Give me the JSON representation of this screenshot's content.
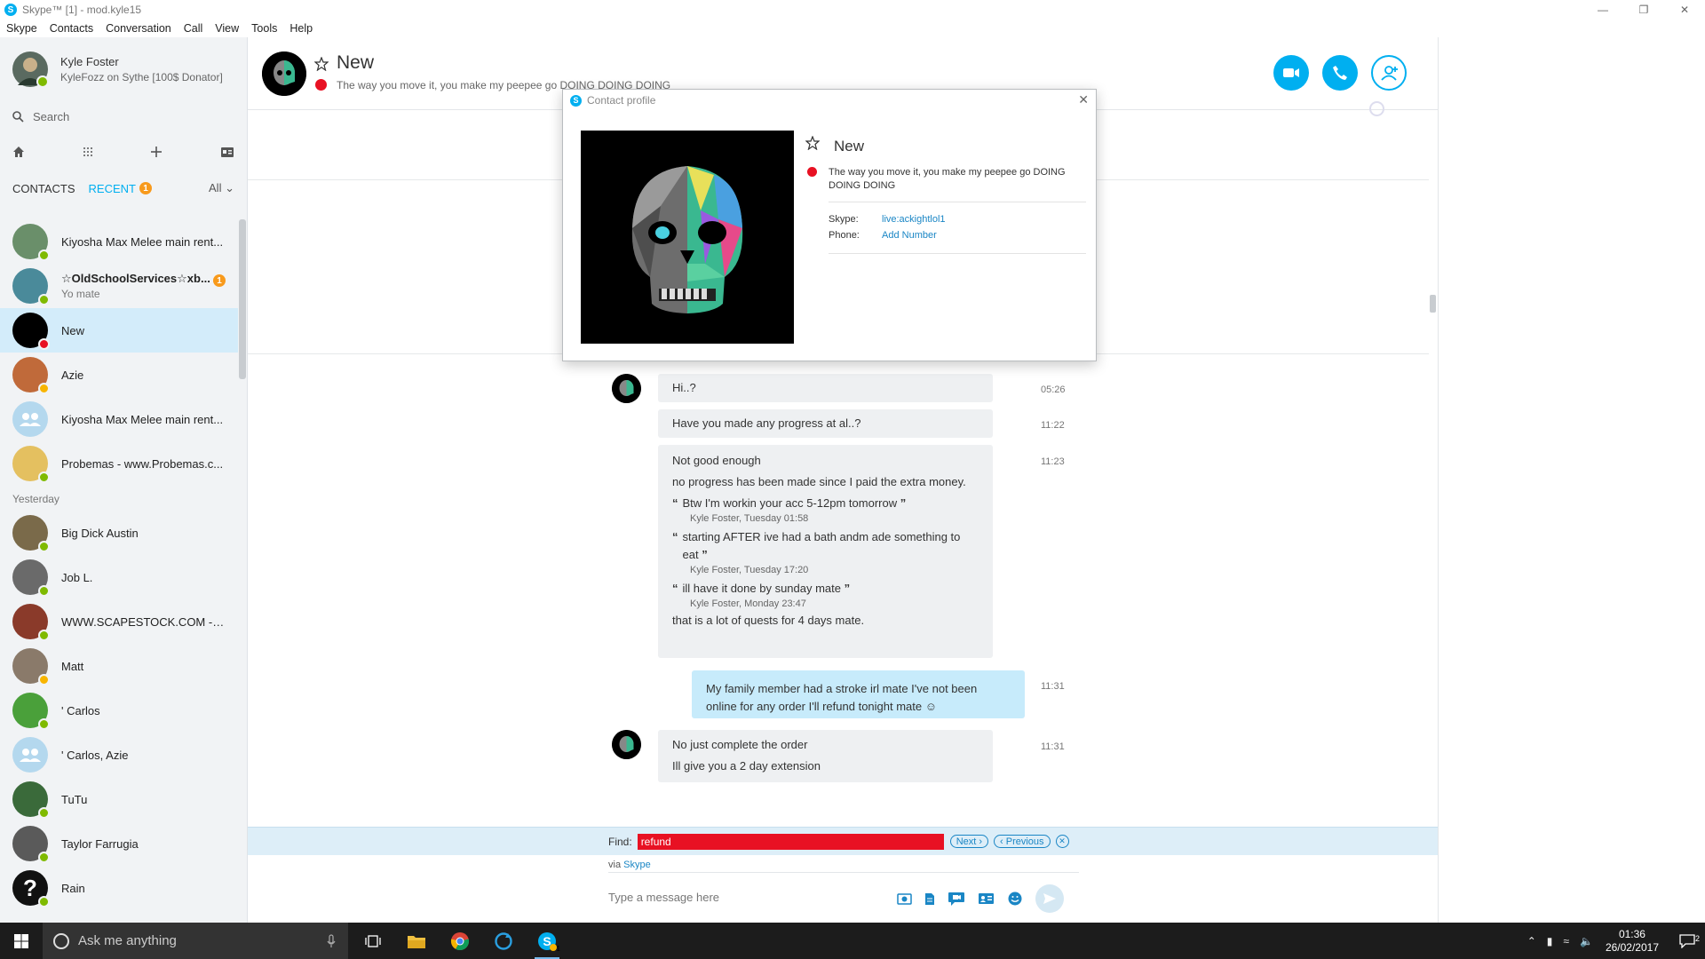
{
  "window": {
    "title": "Skype™ [1] - mod.kyle15"
  },
  "menu": [
    "Skype",
    "Contacts",
    "Conversation",
    "Call",
    "View",
    "Tools",
    "Help"
  ],
  "me": {
    "name": "Kyle Foster",
    "mood": "KyleFozz on Sythe [100$ Donator]"
  },
  "search": {
    "placeholder": "Search"
  },
  "tabs": {
    "contacts": "CONTACTS",
    "recent": "RECENT",
    "recent_badge": "1",
    "filter": "All"
  },
  "recent": [
    {
      "name": "Kiyosha Max Melee main rent...",
      "sub": "",
      "status": "on",
      "color": "#6a8f6a"
    },
    {
      "name": "☆OldSchoolServices☆xb...",
      "sub": "Yo mate",
      "status": "on",
      "color": "#4a8a9a",
      "bold": true,
      "badge": "1"
    },
    {
      "name": "New",
      "sub": "",
      "status": "dnd",
      "color": "#000000",
      "selected": true
    },
    {
      "name": "Azie",
      "sub": "",
      "status": "away",
      "color": "#c06a3a"
    },
    {
      "name": "Kiyosha Max Melee main rent...",
      "sub": "",
      "status": "",
      "color": "#b4d8ee",
      "group": true
    },
    {
      "name": "Probemas - www.Probemas.c...",
      "sub": "",
      "status": "on",
      "color": "#e4c060"
    }
  ],
  "yesterday_label": "Yesterday",
  "yesterday": [
    {
      "name": "Big Dick Austin",
      "status": "on",
      "color": "#7a6a4a"
    },
    {
      "name": "Job L.",
      "status": "on",
      "color": "#6a6a6a"
    },
    {
      "name": "WWW.SCAPESTOCK.COM -RS...",
      "status": "on",
      "color": "#8a3a2a"
    },
    {
      "name": "Matt",
      "status": "away",
      "color": "#8a7a6a"
    },
    {
      "name": "' Carlos",
      "status": "on",
      "color": "#4aa03a"
    },
    {
      "name": "' Carlos, Azie",
      "status": "",
      "color": "#b4d8ee",
      "group": true
    },
    {
      "name": "TuTu",
      "status": "on",
      "color": "#3a6a3a"
    },
    {
      "name": "Taylor Farrugia",
      "status": "on",
      "color": "#5a5a5a"
    },
    {
      "name": "Rain",
      "status": "on",
      "color": "#111111",
      "question": true
    }
  ],
  "conversation": {
    "name": "New",
    "mood": "The way you move it, you make my peepee go DOING DOING DOING",
    "messages": [
      {
        "text": "Hi..?",
        "time": "05:26"
      },
      {
        "text": "Have you made any progress at al..?",
        "time": "11:22"
      },
      {
        "text": "Not good enough",
        "time": "11:23"
      },
      {
        "text": "no progress has been made since I paid the extra money."
      },
      {
        "quote": "Btw I'm workin your acc 5-12pm tomorrow",
        "meta": "Kyle Foster, Tuesday 01:58"
      },
      {
        "quote": "starting AFTER ive had a bath andm ade something to eat",
        "meta": "Kyle Foster, Tuesday 17:20"
      },
      {
        "quote": "ill have it done by sunday mate",
        "meta": "Kyle Foster, Monday 23:47"
      },
      {
        "text": "that is a lot of quests for 4 days mate."
      },
      {
        "text": "My family member had a stroke irl mate I've not been online for any order I'll refund tonight mate ☺",
        "time": "11:31",
        "mine": true
      },
      {
        "text": "No just complete the order",
        "time": "11:31"
      },
      {
        "text": "Ill give you a 2 day extension"
      }
    ]
  },
  "find": {
    "label": "Find:",
    "value": "refund",
    "next": "Next ›",
    "prev": "‹ Previous"
  },
  "via": {
    "prefix": "via",
    "service": "Skype"
  },
  "composer": {
    "placeholder": "Type a message here"
  },
  "profile": {
    "title": "Contact profile",
    "name": "New",
    "mood": "The way you move it, you make my peepee go DOING DOING DOING",
    "skype_label": "Skype:",
    "skype_value": "live:ackightlol1",
    "phone_label": "Phone:",
    "phone_value": "Add Number"
  },
  "taskbar": {
    "search_placeholder": "Ask me anything",
    "time": "01:36",
    "date": "26/02/2017",
    "notif_count": "2",
    "skype_badge": "1"
  },
  "colors": {
    "accent": "#00aff0",
    "find_highlight": "#e81123",
    "online": "#7fba00",
    "away": "#f8b500",
    "dnd": "#e81123"
  }
}
